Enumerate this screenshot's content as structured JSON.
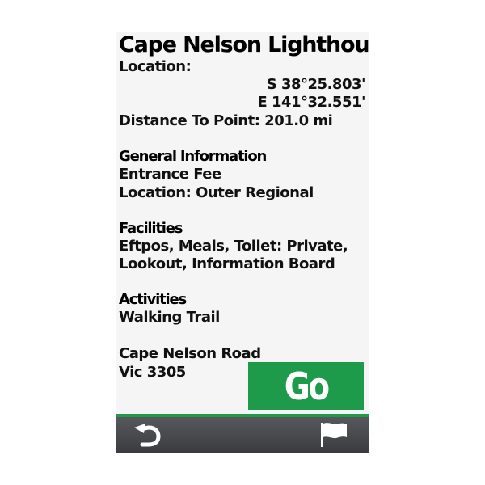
{
  "poi": {
    "title": "Cape Nelson Lighthouse",
    "location_label": "Location:",
    "lat": "S   38°25.803'",
    "lon": "E  141°32.551'",
    "distance": "Distance To Point: 201.0 mi"
  },
  "general": {
    "heading": "General Information",
    "line1": "Entrance Fee",
    "line2": "Location: Outer Regional"
  },
  "facilities": {
    "heading": "Facilities",
    "line1": "Eftpos, Meals, Toilet: Private,",
    "line2": "Lookout, Information Board"
  },
  "activities": {
    "heading": "Activities",
    "line1": "Walking Trail"
  },
  "address": {
    "line1": "Cape Nelson Road",
    "line2": "Vic 3305"
  },
  "actions": {
    "go_label": "Go"
  },
  "toolbar": {
    "back_icon": "back-arrow-icon",
    "flag_icon": "flag-icon"
  },
  "colors": {
    "accent_green": "#1e9b4a",
    "toolbar": "#46484b",
    "background": "#f5f5f5"
  }
}
